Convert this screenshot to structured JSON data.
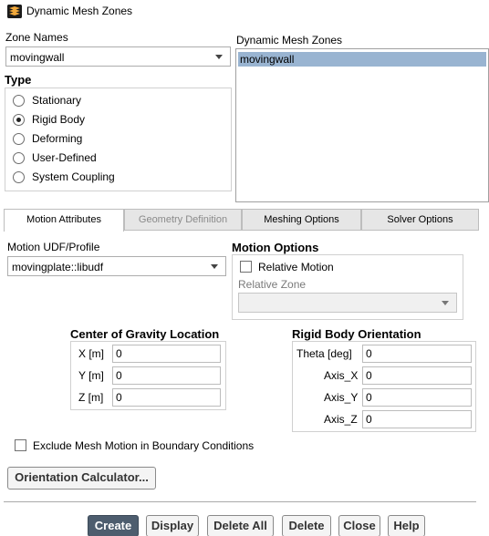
{
  "window": {
    "title": "Dynamic Mesh Zones"
  },
  "zone_names": {
    "label": "Zone Names",
    "value": "movingwall"
  },
  "type": {
    "label": "Type",
    "options": [
      "Stationary",
      "Rigid Body",
      "Deforming",
      "User-Defined",
      "System Coupling"
    ],
    "selected": "Rigid Body"
  },
  "dynamic_zones": {
    "label": "Dynamic Mesh Zones",
    "items": [
      "movingwall"
    ],
    "selected": "movingwall"
  },
  "tabs": [
    {
      "label": "Motion Attributes"
    },
    {
      "label": "Geometry Definition"
    },
    {
      "label": "Meshing Options"
    },
    {
      "label": "Solver Options"
    }
  ],
  "motion_udf": {
    "label": "Motion UDF/Profile",
    "value": "movingplate::libudf"
  },
  "motion_options": {
    "label": "Motion Options",
    "relative_motion_label": "Relative Motion",
    "relative_motion_checked": false,
    "relative_zone_label": "Relative Zone",
    "relative_zone_value": ""
  },
  "cog": {
    "label": "Center of Gravity Location",
    "x_label": "X [m]",
    "x_value": "0",
    "y_label": "Y [m]",
    "y_value": "0",
    "z_label": "Z [m]",
    "z_value": "0"
  },
  "orientation": {
    "label": "Rigid Body Orientation",
    "theta_label": "Theta [deg]",
    "theta_value": "0",
    "ax_label": "Axis_X",
    "ax_value": "0",
    "ay_label": "Axis_Y",
    "ay_value": "0",
    "az_label": "Axis_Z",
    "az_value": "0"
  },
  "exclude_mesh_motion": {
    "label": "Exclude Mesh Motion in Boundary Conditions",
    "checked": false
  },
  "orientation_calc": {
    "label": "Orientation Calculator..."
  },
  "buttons": {
    "create": "Create",
    "display": "Display",
    "delete_all": "Delete All",
    "delete": "Delete",
    "close": "Close",
    "help": "Help"
  }
}
